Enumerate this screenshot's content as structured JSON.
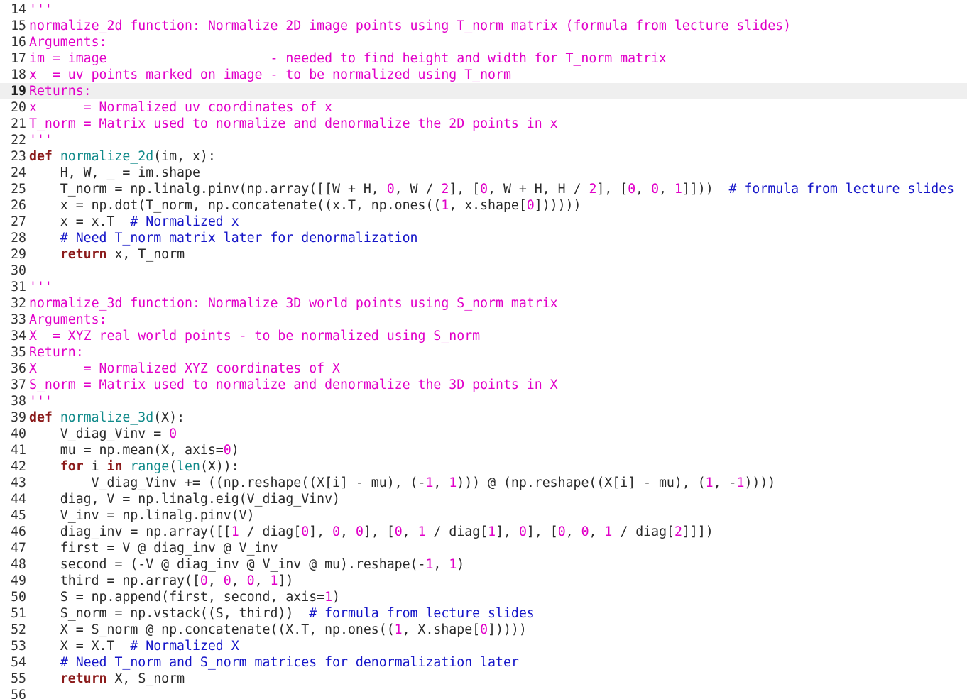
{
  "editor": {
    "first_line": 14,
    "current_line": 19,
    "lines": [
      [
        [
          "str",
          "'''"
        ]
      ],
      [
        [
          "str",
          "normalize_2d function: Normalize 2D image points using T_norm matrix (formula from lecture slides)"
        ]
      ],
      [
        [
          "str",
          "Arguments:"
        ]
      ],
      [
        [
          "str",
          "im = image                     - needed to find height and width for T_norm matrix"
        ]
      ],
      [
        [
          "str",
          "x  = uv points marked on image - to be normalized using T_norm"
        ]
      ],
      [
        [
          "str",
          "Returns:"
        ]
      ],
      [
        [
          "str",
          "x      = Normalized uv coordinates of x"
        ]
      ],
      [
        [
          "str",
          "T_norm = Matrix used to normalize and denormalize the 2D points in x"
        ]
      ],
      [
        [
          "str",
          "'''"
        ]
      ],
      [
        [
          "kw",
          "def"
        ],
        [
          "txt",
          " "
        ],
        [
          "fn",
          "normalize_2d"
        ],
        [
          "txt",
          "(im, x):"
        ]
      ],
      [
        [
          "txt",
          "    H, W, _ = im.shape"
        ]
      ],
      [
        [
          "txt",
          "    T_norm = np.linalg.pinv(np.array([[W + H, "
        ],
        [
          "num",
          "0"
        ],
        [
          "txt",
          ", W / "
        ],
        [
          "num",
          "2"
        ],
        [
          "txt",
          "], ["
        ],
        [
          "num",
          "0"
        ],
        [
          "txt",
          ", W + H, H / "
        ],
        [
          "num",
          "2"
        ],
        [
          "txt",
          "], ["
        ],
        [
          "num",
          "0"
        ],
        [
          "txt",
          ", "
        ],
        [
          "num",
          "0"
        ],
        [
          "txt",
          ", "
        ],
        [
          "num",
          "1"
        ],
        [
          "txt",
          "]]))  "
        ],
        [
          "cm",
          "# formula from lecture slides"
        ]
      ],
      [
        [
          "txt",
          "    x = np.dot(T_norm, np.concatenate((x.T, np.ones(("
        ],
        [
          "num",
          "1"
        ],
        [
          "txt",
          ", x.shape["
        ],
        [
          "num",
          "0"
        ],
        [
          "txt",
          "])))))"
        ]
      ],
      [
        [
          "txt",
          "    x = x.T  "
        ],
        [
          "cm",
          "# Normalized x"
        ]
      ],
      [
        [
          "txt",
          "    "
        ],
        [
          "cm",
          "# Need T_norm matrix later for denormalization"
        ]
      ],
      [
        [
          "txt",
          "    "
        ],
        [
          "kw",
          "return"
        ],
        [
          "txt",
          " x, T_norm"
        ]
      ],
      [],
      [
        [
          "str",
          "'''"
        ]
      ],
      [
        [
          "str",
          "normalize_3d function: Normalize 3D world points using S_norm matrix"
        ]
      ],
      [
        [
          "str",
          "Arguments:"
        ]
      ],
      [
        [
          "str",
          "X  = XYZ real world points - to be normalized using S_norm"
        ]
      ],
      [
        [
          "str",
          "Return:"
        ]
      ],
      [
        [
          "str",
          "X      = Normalized XYZ coordinates of X"
        ]
      ],
      [
        [
          "str",
          "S_norm = Matrix used to normalize and denormalize the 3D points in X"
        ]
      ],
      [
        [
          "str",
          "'''"
        ]
      ],
      [
        [
          "kw",
          "def"
        ],
        [
          "txt",
          " "
        ],
        [
          "fn",
          "normalize_3d"
        ],
        [
          "txt",
          "(X):"
        ]
      ],
      [
        [
          "txt",
          "    V_diag_Vinv = "
        ],
        [
          "num",
          "0"
        ]
      ],
      [
        [
          "txt",
          "    mu = np.mean(X, axis="
        ],
        [
          "num",
          "0"
        ],
        [
          "txt",
          ")"
        ]
      ],
      [
        [
          "txt",
          "    "
        ],
        [
          "kw",
          "for"
        ],
        [
          "txt",
          " i "
        ],
        [
          "kw",
          "in"
        ],
        [
          "txt",
          " "
        ],
        [
          "bi",
          "range"
        ],
        [
          "txt",
          "("
        ],
        [
          "bi",
          "len"
        ],
        [
          "txt",
          "(X)):"
        ]
      ],
      [
        [
          "txt",
          "        V_diag_Vinv += ((np.reshape((X[i] - mu), (-"
        ],
        [
          "num",
          "1"
        ],
        [
          "txt",
          ", "
        ],
        [
          "num",
          "1"
        ],
        [
          "txt",
          "))) @ (np.reshape((X[i] - mu), ("
        ],
        [
          "num",
          "1"
        ],
        [
          "txt",
          ", -"
        ],
        [
          "num",
          "1"
        ],
        [
          "txt",
          "))))"
        ]
      ],
      [
        [
          "txt",
          "    diag, V = np.linalg.eig(V_diag_Vinv)"
        ]
      ],
      [
        [
          "txt",
          "    V_inv = np.linalg.pinv(V)"
        ]
      ],
      [
        [
          "txt",
          "    diag_inv = np.array([["
        ],
        [
          "num",
          "1"
        ],
        [
          "txt",
          " / diag["
        ],
        [
          "num",
          "0"
        ],
        [
          "txt",
          "], "
        ],
        [
          "num",
          "0"
        ],
        [
          "txt",
          ", "
        ],
        [
          "num",
          "0"
        ],
        [
          "txt",
          "], ["
        ],
        [
          "num",
          "0"
        ],
        [
          "txt",
          ", "
        ],
        [
          "num",
          "1"
        ],
        [
          "txt",
          " / diag["
        ],
        [
          "num",
          "1"
        ],
        [
          "txt",
          "], "
        ],
        [
          "num",
          "0"
        ],
        [
          "txt",
          "], ["
        ],
        [
          "num",
          "0"
        ],
        [
          "txt",
          ", "
        ],
        [
          "num",
          "0"
        ],
        [
          "txt",
          ", "
        ],
        [
          "num",
          "1"
        ],
        [
          "txt",
          " / diag["
        ],
        [
          "num",
          "2"
        ],
        [
          "txt",
          "]]])"
        ]
      ],
      [
        [
          "txt",
          "    first = V @ diag_inv @ V_inv"
        ]
      ],
      [
        [
          "txt",
          "    second = (-V @ diag_inv @ V_inv @ mu).reshape(-"
        ],
        [
          "num",
          "1"
        ],
        [
          "txt",
          ", "
        ],
        [
          "num",
          "1"
        ],
        [
          "txt",
          ")"
        ]
      ],
      [
        [
          "txt",
          "    third = np.array(["
        ],
        [
          "num",
          "0"
        ],
        [
          "txt",
          ", "
        ],
        [
          "num",
          "0"
        ],
        [
          "txt",
          ", "
        ],
        [
          "num",
          "0"
        ],
        [
          "txt",
          ", "
        ],
        [
          "num",
          "1"
        ],
        [
          "txt",
          "])"
        ]
      ],
      [
        [
          "txt",
          "    S = np.append(first, second, axis="
        ],
        [
          "num",
          "1"
        ],
        [
          "txt",
          ")"
        ]
      ],
      [
        [
          "txt",
          "    S_norm = np.vstack((S, third))  "
        ],
        [
          "cm",
          "# formula from lecture slides"
        ]
      ],
      [
        [
          "txt",
          "    X = S_norm @ np.concatenate((X.T, np.ones(("
        ],
        [
          "num",
          "1"
        ],
        [
          "txt",
          ", X.shape["
        ],
        [
          "num",
          "0"
        ],
        [
          "txt",
          "]))))"
        ]
      ],
      [
        [
          "txt",
          "    X = X.T  "
        ],
        [
          "cm",
          "# Normalized X"
        ]
      ],
      [
        [
          "txt",
          "    "
        ],
        [
          "cm",
          "# Need T_norm and S_norm matrices for denormalization later"
        ]
      ],
      [
        [
          "txt",
          "    "
        ],
        [
          "kw",
          "return"
        ],
        [
          "txt",
          " X, S_norm"
        ]
      ],
      []
    ]
  }
}
